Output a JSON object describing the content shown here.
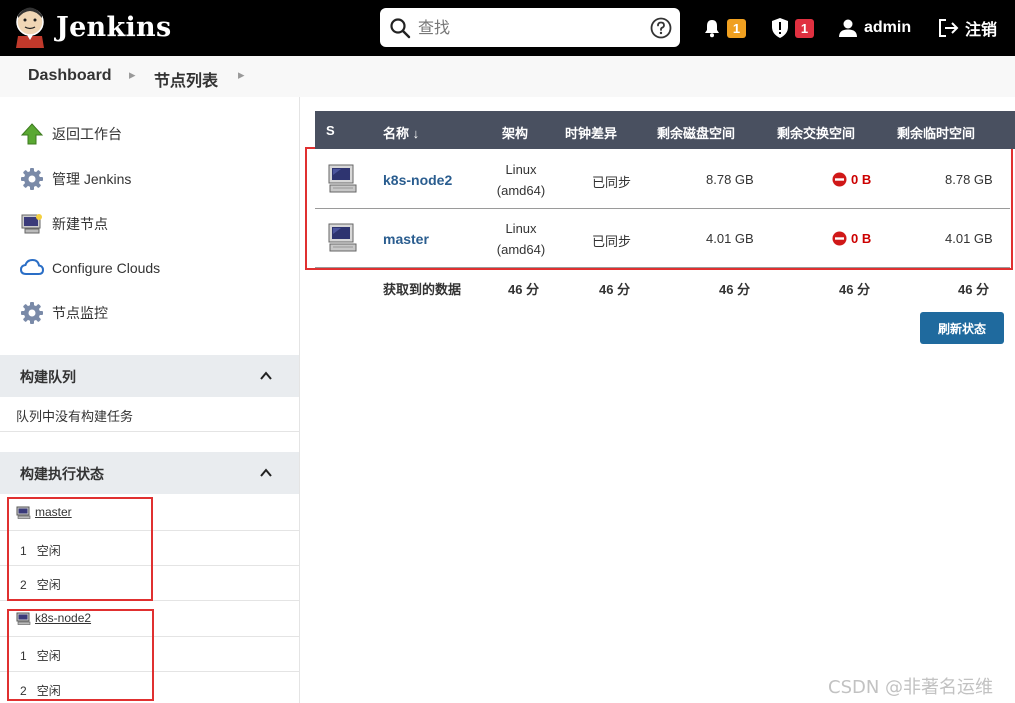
{
  "header": {
    "brand": "Jenkins",
    "search_placeholder": "查找",
    "notifications_count": "1",
    "security_count": "1",
    "user": "admin",
    "logout": "注销"
  },
  "breadcrumb": [
    "Dashboard",
    "节点列表"
  ],
  "sidebar": {
    "tasks": [
      {
        "label": "返回工作台",
        "icon": "up-arrow-icon"
      },
      {
        "label": "管理 Jenkins",
        "icon": "gear-icon"
      },
      {
        "label": "新建节点",
        "icon": "computer-icon"
      },
      {
        "label": "Configure Clouds",
        "icon": "cloud-icon"
      },
      {
        "label": "节点监控",
        "icon": "gear-icon"
      }
    ],
    "build_queue": {
      "title": "构建队列",
      "empty_text": "队列中没有构建任务"
    },
    "executors": {
      "title": "构建执行状态",
      "computers": [
        {
          "name": "master",
          "executors": [
            {
              "num": "1",
              "status": "空闲"
            },
            {
              "num": "2",
              "status": "空闲"
            }
          ]
        },
        {
          "name": "k8s-node2",
          "executors": [
            {
              "num": "1",
              "status": "空闲"
            },
            {
              "num": "2",
              "status": "空闲"
            }
          ]
        }
      ]
    }
  },
  "table": {
    "headers": {
      "s": "S",
      "name": "名称 ↓",
      "arch": "架构",
      "clock": "时钟差异",
      "disk": "剩余磁盘空间",
      "swap": "剩余交换空间",
      "temp": "剩余临时空间"
    },
    "rows": [
      {
        "name": "k8s-node2",
        "arch_os": "Linux",
        "arch_cpu": "(amd64)",
        "clock": "已同步",
        "disk": "8.78 GB",
        "swap": "0 B",
        "temp": "8.78 GB"
      },
      {
        "name": "master",
        "arch_os": "Linux",
        "arch_cpu": "(amd64)",
        "clock": "已同步",
        "disk": "4.01 GB",
        "swap": "0 B",
        "temp": "4.01 GB"
      }
    ],
    "summary": {
      "label": "获取到的数据",
      "arch": "46 分",
      "clock": "46 分",
      "disk": "46 分",
      "swap": "46 分",
      "temp": "46 分"
    }
  },
  "refresh_button": "刷新状态",
  "watermark": "CSDN @非著名运维",
  "colors": {
    "header_bg": "#000000",
    "notif_badge": "#f0a020",
    "security_badge": "#e03040",
    "table_head": "#495060",
    "link": "#2a5d8f",
    "refresh": "#1f6a9e",
    "highlight": "#e03030"
  }
}
